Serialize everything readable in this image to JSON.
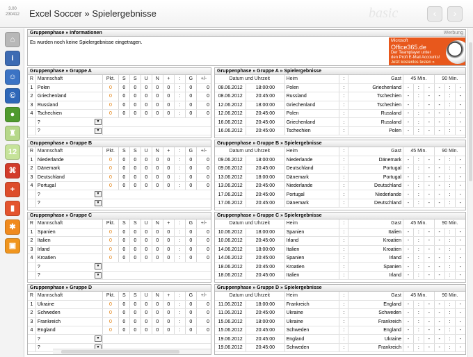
{
  "app": {
    "version": "3.00",
    "build": "230412",
    "title": "Excel Soccer » Spielergebnisse",
    "edition": "basic"
  },
  "nav": {
    "back": "‹",
    "forward": "›"
  },
  "sidebar": [
    {
      "name": "home-icon",
      "glyph": "⌂",
      "color": "#b8b8b8"
    },
    {
      "name": "info-icon",
      "glyph": "i",
      "color": "#3d6bb3"
    },
    {
      "name": "users-icon",
      "glyph": "☺",
      "color": "#3b73c4"
    },
    {
      "name": "copyright-icon",
      "glyph": "©",
      "color": "#2e67b8"
    },
    {
      "name": "soccer-ball-icon",
      "glyph": "●",
      "color": "#4f9a2e"
    },
    {
      "name": "trophy-icon",
      "glyph": "♜",
      "color": "#b6d88a"
    },
    {
      "name": "numbers-icon",
      "glyph": "12",
      "color": "#c6e39a"
    },
    {
      "name": "tournament-bracket-icon",
      "glyph": "⌘",
      "color": "#d23b2a"
    },
    {
      "name": "add-user-icon",
      "glyph": "+",
      "color": "#dd4d2b"
    },
    {
      "name": "statistics-icon",
      "glyph": "▮",
      "color": "#e4542e"
    },
    {
      "name": "settings-icon",
      "glyph": "✱",
      "color": "#f08a1e"
    },
    {
      "name": "save-icon",
      "glyph": "▣",
      "color": "#f0951e"
    }
  ],
  "info": {
    "header": "Gruppenphase  » Informationen",
    "werbung": "Werbung",
    "text": "Es wurden noch keine Spielergebnisse eingetragen."
  },
  "ad": {
    "brand": "Microsoft",
    "product": "Office365.de",
    "line1": "Der Teamplayer unter",
    "line2": "den Profi E-Mail Accounts!",
    "link": "Jetzt kostenlos testen »"
  },
  "table_headers": [
    "R",
    "Mannschaft",
    "Pkt.",
    "S",
    "S",
    "U",
    "N",
    "+",
    ":",
    "G",
    "+/-"
  ],
  "match_headers": [
    "Datum und Uhrzeit",
    "Heim",
    ":",
    "Gast",
    "45 Min.",
    "90 Min."
  ],
  "groups": [
    {
      "title": "Gruppenphase  » Gruppe A",
      "mtitle": "Gruppenphase  » Gruppe A » Spielergebnisse",
      "teams": [
        "Polen",
        "Griechenland",
        "Russland",
        "Tschechien"
      ],
      "matches": [
        [
          "08.06.2012",
          "18:00:00",
          "Polen",
          "Griechenland"
        ],
        [
          "08.06.2012",
          "20:45:00",
          "Russland",
          "Tschechien"
        ],
        [
          "12.06.2012",
          "18:00:00",
          "Griechenland",
          "Tschechien"
        ],
        [
          "12.06.2012",
          "20:45:00",
          "Polen",
          "Russland"
        ],
        [
          "16.06.2012",
          "20:45:00",
          "Griechenland",
          "Russland"
        ],
        [
          "16.06.2012",
          "20:45:00",
          "Tschechien",
          "Polen"
        ]
      ]
    },
    {
      "title": "Gruppenphase  » Gruppe B",
      "mtitle": "Gruppenphase  » Gruppe B » Spielergebnisse",
      "teams": [
        "Niederlande",
        "Dänemark",
        "Deutschland",
        "Portugal"
      ],
      "matches": [
        [
          "09.06.2012",
          "18:00:00",
          "Niederlande",
          "Dänemark"
        ],
        [
          "09.06.2012",
          "20:45:00",
          "Deutschland",
          "Portugal"
        ],
        [
          "13.06.2012",
          "18:00:00",
          "Dänemark",
          "Portugal"
        ],
        [
          "13.06.2012",
          "20:45:00",
          "Niederlande",
          "Deutschland"
        ],
        [
          "17.06.2012",
          "20:45:00",
          "Portugal",
          "Niederlande"
        ],
        [
          "17.06.2012",
          "20:45:00",
          "Dänemark",
          "Deutschland"
        ]
      ]
    },
    {
      "title": "Gruppenphase  » Gruppe C",
      "mtitle": "Gruppenphase  » Gruppe C » Spielergebnisse",
      "teams": [
        "Spanien",
        "Italien",
        "Irland",
        "Kroatien"
      ],
      "matches": [
        [
          "10.06.2012",
          "18:00:00",
          "Spanien",
          "Italien"
        ],
        [
          "10.06.2012",
          "20:45:00",
          "Irland",
          "Kroatien"
        ],
        [
          "14.06.2012",
          "18:00:00",
          "Italien",
          "Kroatien"
        ],
        [
          "14.06.2012",
          "20:45:00",
          "Spanien",
          "Irland"
        ],
        [
          "18.06.2012",
          "20:45:00",
          "Kroatien",
          "Spanien"
        ],
        [
          "18.06.2012",
          "20:45:00",
          "Italien",
          "Irland"
        ]
      ]
    },
    {
      "title": "Gruppenphase  » Gruppe D",
      "mtitle": "Gruppenphase  » Gruppe D » Spielergebnisse",
      "teams": [
        "Ukraine",
        "Schweden",
        "Frankreich",
        "England"
      ],
      "matches": [
        [
          "11.06.2012",
          "18:00:00",
          "Frankreich",
          "England"
        ],
        [
          "11.06.2012",
          "20:45:00",
          "Ukraine",
          "Schweden"
        ],
        [
          "15.06.2012",
          "18:00:00",
          "Ukraine",
          "Frankreich"
        ],
        [
          "15.06.2012",
          "20:45:00",
          "Schweden",
          "England"
        ],
        [
          "19.06.2012",
          "20:45:00",
          "England",
          "Ukraine"
        ],
        [
          "19.06.2012",
          "20:45:00",
          "Schweden",
          "Frankreich"
        ]
      ]
    }
  ],
  "zero": "0",
  "colon": ":",
  "dash": "-",
  "placeholder": "?"
}
